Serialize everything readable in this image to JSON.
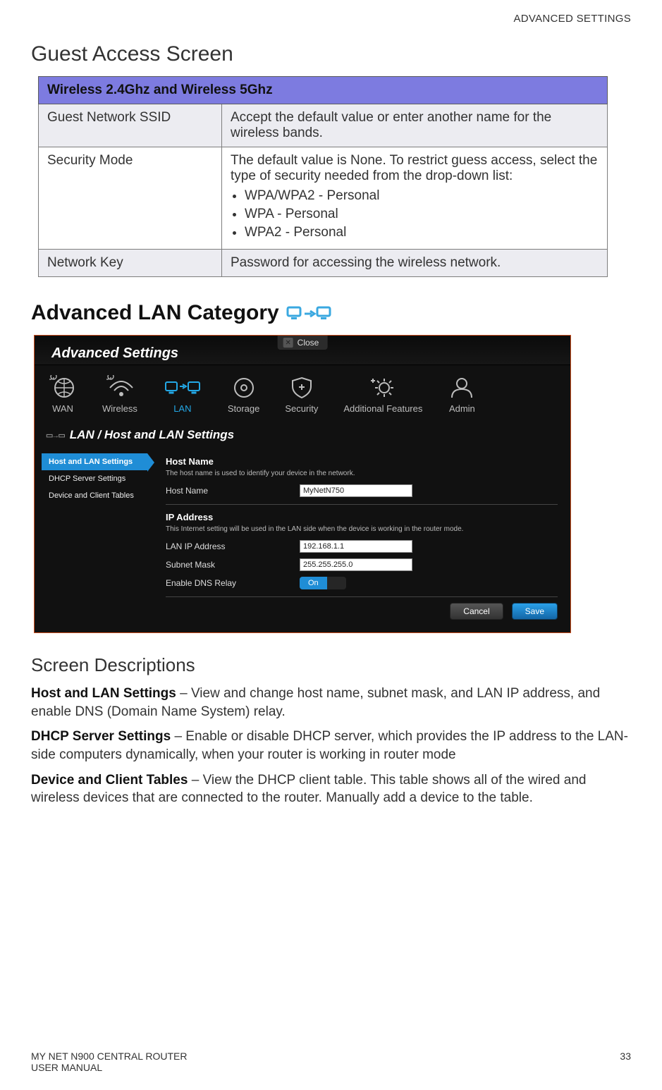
{
  "header_right": "ADVANCED SETTINGS",
  "title1": "Guest Access Screen",
  "table": {
    "header": "Wireless 2.4Ghz and Wireless 5Ghz",
    "rows": [
      {
        "label": "Guest Network SSID",
        "text": "Accept the default value or enter another name for the wireless bands."
      },
      {
        "label": "Security Mode",
        "text": "The default value is None. To restrict guess access, select the type of security needed from the drop-down list:",
        "list": [
          "WPA/WPA2 - Personal",
          "WPA - Personal",
          "WPA2 - Personal"
        ]
      },
      {
        "label": "Network Key",
        "text": "Password for accessing the wireless network."
      }
    ]
  },
  "title2": "Advanced LAN Category",
  "shot": {
    "close_label": "Close",
    "top_title": "Advanced Settings",
    "nav": [
      {
        "label": "WAN"
      },
      {
        "label": "Wireless"
      },
      {
        "label": "LAN",
        "active": true
      },
      {
        "label": "Storage"
      },
      {
        "label": "Security"
      },
      {
        "label": "Additional Features"
      },
      {
        "label": "Admin"
      }
    ],
    "section_bar": "LAN / Host and LAN Settings",
    "sidemenu": [
      {
        "label": "Host and LAN Settings",
        "active": true
      },
      {
        "label": "DHCP Server Settings"
      },
      {
        "label": "Device and Client Tables"
      }
    ],
    "groups": [
      {
        "title": "Host Name",
        "desc": "The host name is used to identify your device in the network.",
        "rows": [
          {
            "label": "Host Name",
            "value": "MyNetN750",
            "type": "text"
          }
        ]
      },
      {
        "title": "IP Address",
        "desc": "This Internet setting will be used in the LAN side when the device is working in the router mode.",
        "rows": [
          {
            "label": "LAN IP Address",
            "value": "192.168.1.1",
            "type": "text"
          },
          {
            "label": "Subnet Mask",
            "value": "255.255.255.0",
            "type": "text"
          },
          {
            "label": "Enable DNS Relay",
            "value": "On",
            "type": "toggle"
          }
        ]
      }
    ],
    "buttons": {
      "cancel": "Cancel",
      "save": "Save"
    }
  },
  "title3": "Screen Descriptions",
  "descriptions": [
    {
      "bold": "Host and LAN Settings",
      "text": " – View and change host name, subnet mask, and LAN IP address, and enable DNS (Domain Name System) relay."
    },
    {
      "bold": "DHCP Server Settings",
      "text": " – Enable or disable DHCP server, which provides the IP address to the LAN-side computers dynamically, when your router is working in router mode"
    },
    {
      "bold": "Device and Client Tables",
      "text": " – View the DHCP client table. This table shows all of the wired and wireless devices that are connected to the router. Manually add a device to the table."
    }
  ],
  "footer": {
    "left1": "MY NET N900 CENTRAL ROUTER",
    "left2": "USER MANUAL",
    "page": "33"
  }
}
